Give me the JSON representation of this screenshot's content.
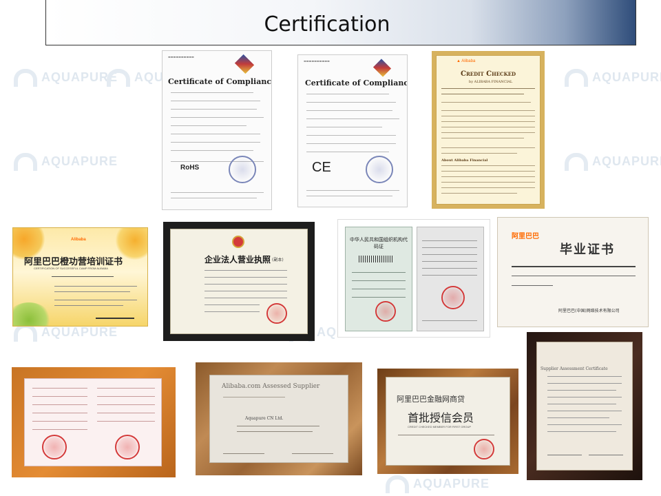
{
  "header": {
    "title": "Certification"
  },
  "watermark": {
    "brand": "AQUAPURE"
  },
  "certificates": {
    "ce_rohs": {
      "title": "Certificate of Compliance",
      "mark": "RoHS"
    },
    "ce_emc": {
      "title": "Certificate of Compliance",
      "mark": "CE"
    },
    "credit_checked": {
      "title": "Credit Checked",
      "subtitle": "by ALIBABA FINANCIAL",
      "about": "About Alibaba Financial"
    },
    "training": {
      "brand": "Alibaba",
      "title": "阿里巴巴橙功营培训证书",
      "subtitle": "CERTIFICATION OF SUCCESSFUL CAMP FROM ALIBABA"
    },
    "business_license": {
      "title": "企业法人营业执照",
      "suffix": "(副本)"
    },
    "org_code": {
      "title": "中华人民共和国组织机构代码证"
    },
    "graduation": {
      "brand": "阿里巴巴",
      "title": "毕业证书",
      "footer": "阿里巴巴(中国)网络技术有限公司"
    },
    "tax_registration": {},
    "assessed_supplier": {
      "title": "Alibaba.com Assessed Supplier",
      "company": "Aquapure CN Ltd."
    },
    "credit_member": {
      "title": "阿里巴巴金融网商贷",
      "main": "首批授信会员",
      "sub": "CREDIT CHECKED MEMBER FOR FIRST GROUP"
    },
    "supplier_assessment": {
      "title": "Supplier Assessment Certificate"
    }
  },
  "colors": {
    "header_dark": "#2f4d7a",
    "frame_wood": "#7a4a22",
    "frame_black": "#1d1d1d",
    "seal_red": "#d43a3a",
    "alibaba_orange": "#ff6a00"
  }
}
